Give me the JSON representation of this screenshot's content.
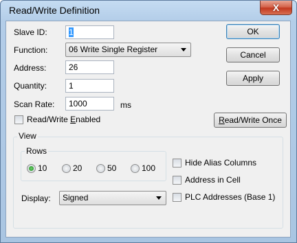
{
  "window": {
    "title": "Read/Write Definition",
    "close_label": "X"
  },
  "form": {
    "slave_id": {
      "label": "Slave ID:",
      "value": "1"
    },
    "function": {
      "label": "Function:",
      "value": "06 Write Single Register"
    },
    "address": {
      "label": "Address:",
      "value": "26"
    },
    "quantity": {
      "label": "Quantity:",
      "value": "1"
    },
    "scan_rate": {
      "label": "Scan Rate:",
      "value": "1000",
      "unit": "ms"
    },
    "rw_enabled": {
      "label_pre": "Read/Write ",
      "label_u": "E",
      "label_post": "nabled",
      "checked": false
    }
  },
  "buttons": {
    "ok": "OK",
    "cancel": "Cancel",
    "apply": "Apply",
    "rw_once_u": "R",
    "rw_once_rest": "ead/Write Once"
  },
  "view": {
    "title": "View",
    "rows_title": "Rows",
    "rows": [
      "10",
      "20",
      "50",
      "100"
    ],
    "rows_selected": "10",
    "hide_alias": "Hide Alias Columns",
    "address_in_cell": "Address in Cell",
    "plc_addresses": "PLC Addresses (Base 1)",
    "display_label": "Display:",
    "display_value": "Signed"
  }
}
